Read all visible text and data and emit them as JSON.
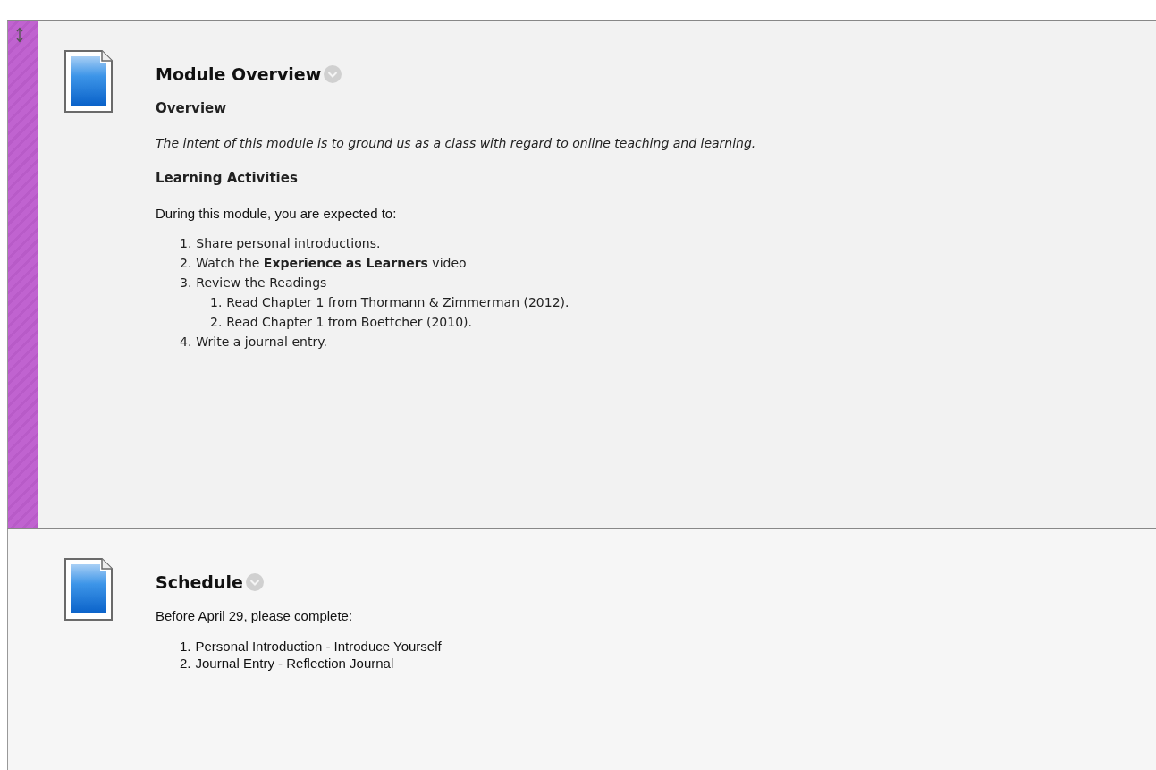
{
  "content_items": [
    {
      "title": "Module Overview",
      "selected": true,
      "blocks": [
        {
          "kind": "underlined-heading",
          "text": "Overview"
        },
        {
          "kind": "italic-text",
          "text": "The intent of this module is to ground us as a class with regard to online teaching and learning."
        },
        {
          "kind": "subheading",
          "text": "Learning Activities"
        },
        {
          "kind": "sans-text",
          "text": "During this module, you are expected to:"
        },
        {
          "kind": "list",
          "items": [
            {
              "number": "1.",
              "text": "Share personal introductions."
            },
            {
              "number": "2.",
              "text": "Watch the **Experience as Learners** video"
            },
            {
              "number": "3.",
              "text": "Review the Readings",
              "children": [
                {
                  "number": "1.",
                  "text": "Read Chapter 1 from Thormann & Zimmerman (2012)."
                },
                {
                  "number": "2.",
                  "text": "Read Chapter 1 from Boettcher (2010)."
                }
              ]
            },
            {
              "number": "4.",
              "text": "Write a journal entry."
            }
          ]
        }
      ]
    },
    {
      "title": "Schedule",
      "selected": false,
      "blocks": [
        {
          "kind": "sans-text",
          "text": "Before April 29, please complete:"
        },
        {
          "kind": "sans-list",
          "items": [
            {
              "number": "1.",
              "text": "Personal Introduction - Introduce Yourself"
            },
            {
              "number": "2.",
              "text": "Journal Entry - Reflection Journal"
            }
          ]
        }
      ]
    }
  ]
}
